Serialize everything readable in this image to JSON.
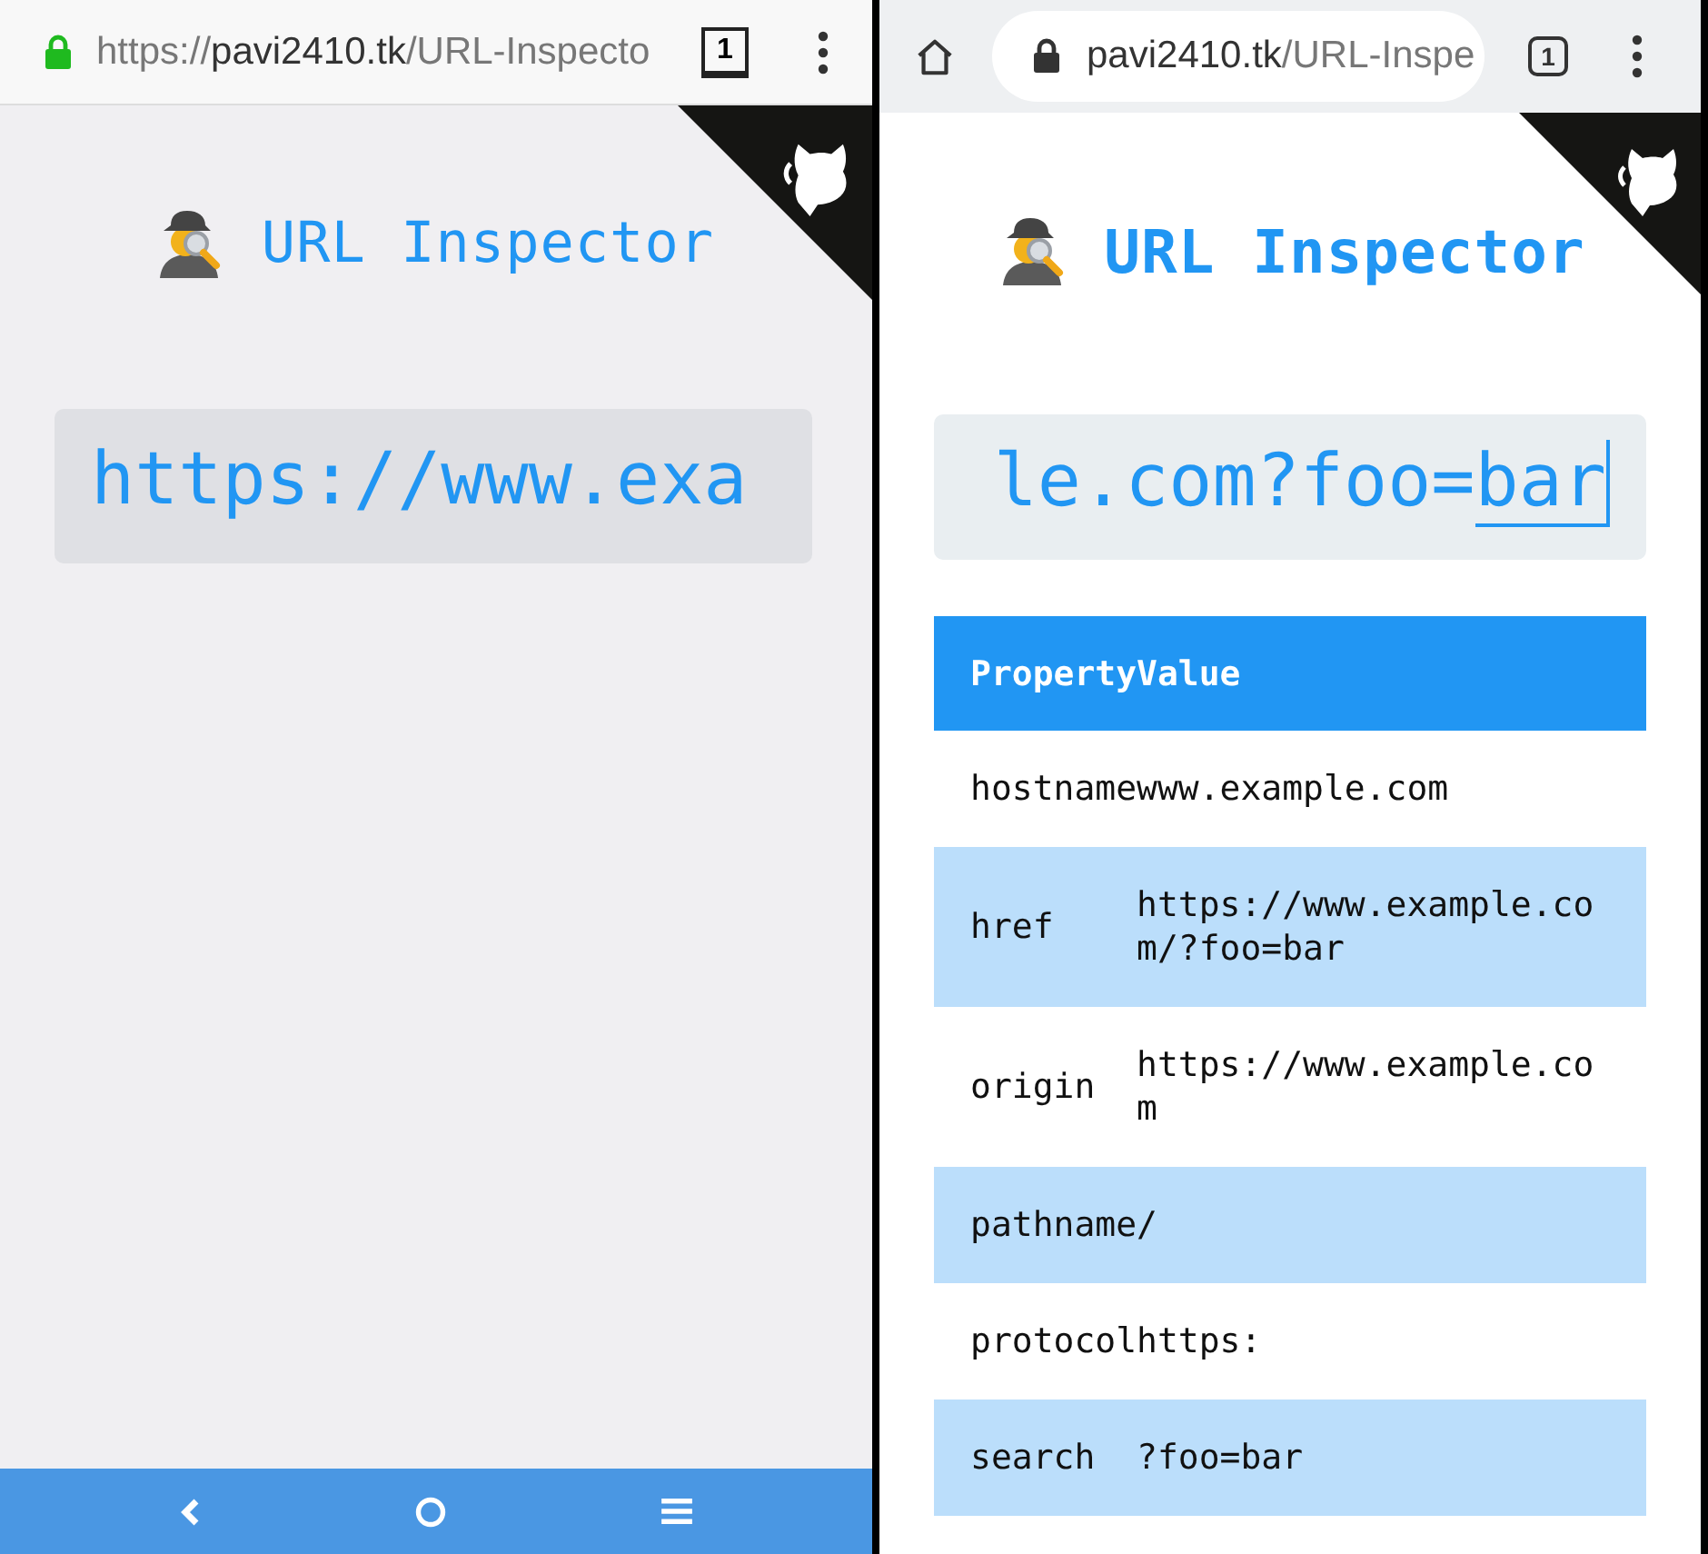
{
  "screens": [
    {
      "kind": "classic",
      "address_bar": {
        "secure": true,
        "scheme": "https://",
        "host": "pavi2410.tk",
        "path": "/URL-Inspecto"
      },
      "tab_count": "1",
      "title": "URL Inspector",
      "input": {
        "value": "https://www.exa"
      },
      "nav_bar": true
    },
    {
      "kind": "modern",
      "address_bar": {
        "secure": true,
        "host": "pavi2410.tk",
        "path": "/URL-Inspe"
      },
      "tab_count": "1",
      "title": "URL Inspector",
      "input": {
        "value": "le.com?foo=",
        "composing": "bar"
      },
      "table": {
        "columns": [
          "Property",
          "Value"
        ],
        "rows": [
          {
            "property": "hostname",
            "value": "www.example.com"
          },
          {
            "property": "href",
            "value": "https://www.example.com/?foo=bar"
          },
          {
            "property": "origin",
            "value": "https://www.example.com"
          },
          {
            "property": "pathname",
            "value": "/"
          },
          {
            "property": "protocol",
            "value": "https:"
          },
          {
            "property": "search",
            "value": "?foo=bar"
          }
        ]
      }
    }
  ]
}
